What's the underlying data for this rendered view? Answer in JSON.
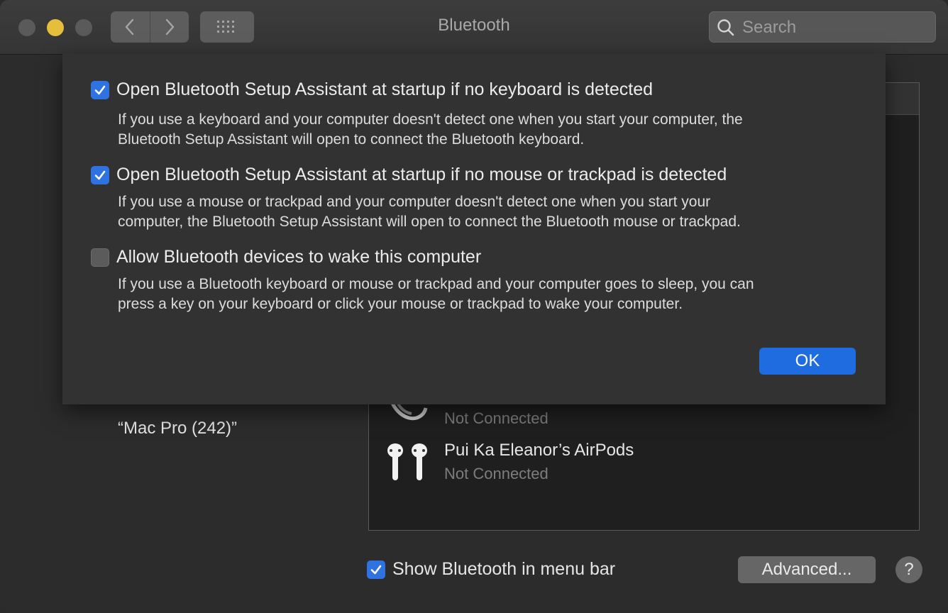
{
  "window": {
    "title": "Bluetooth",
    "search": {
      "placeholder": "Search",
      "value": ""
    }
  },
  "sidebar": {
    "device_name": "“Mac Pro (242)”"
  },
  "devices": [
    {
      "name": "",
      "status": "Not Connected",
      "icon": "headphones-icon"
    },
    {
      "name": "Pui Ka Eleanor’s AirPods",
      "status": "Not Connected",
      "icon": "airpods-icon"
    }
  ],
  "footer": {
    "show_in_menu_bar": {
      "label": "Show Bluetooth in menu bar",
      "checked": true
    },
    "advanced_label": "Advanced...",
    "help_label": "?"
  },
  "sheet": {
    "options": [
      {
        "label": "Open Bluetooth Setup Assistant at startup if no keyboard is detected",
        "checked": true,
        "description_lines": [
          "If you use a keyboard and your computer doesn't detect one when you start your computer, the",
          "Bluetooth Setup Assistant will open to connect the Bluetooth keyboard."
        ]
      },
      {
        "label": "Open Bluetooth Setup Assistant at startup if no mouse or trackpad is detected",
        "checked": true,
        "description_lines": [
          "If you use a mouse or trackpad and your computer doesn't detect one when you start your",
          "computer, the Bluetooth Setup Assistant will open to connect the Bluetooth mouse or trackpad."
        ]
      },
      {
        "label": "Allow Bluetooth devices to wake this computer",
        "checked": false,
        "description_lines": [
          "If you use a Bluetooth keyboard or mouse or trackpad and your computer goes to sleep, you can",
          "press a key on your keyboard or click your mouse or trackpad to wake your computer."
        ]
      }
    ],
    "ok_label": "OK"
  },
  "colors": {
    "accent": "#2f73e2",
    "ok_button": "#1f6ce0",
    "minimize": "#e5bf3c"
  }
}
